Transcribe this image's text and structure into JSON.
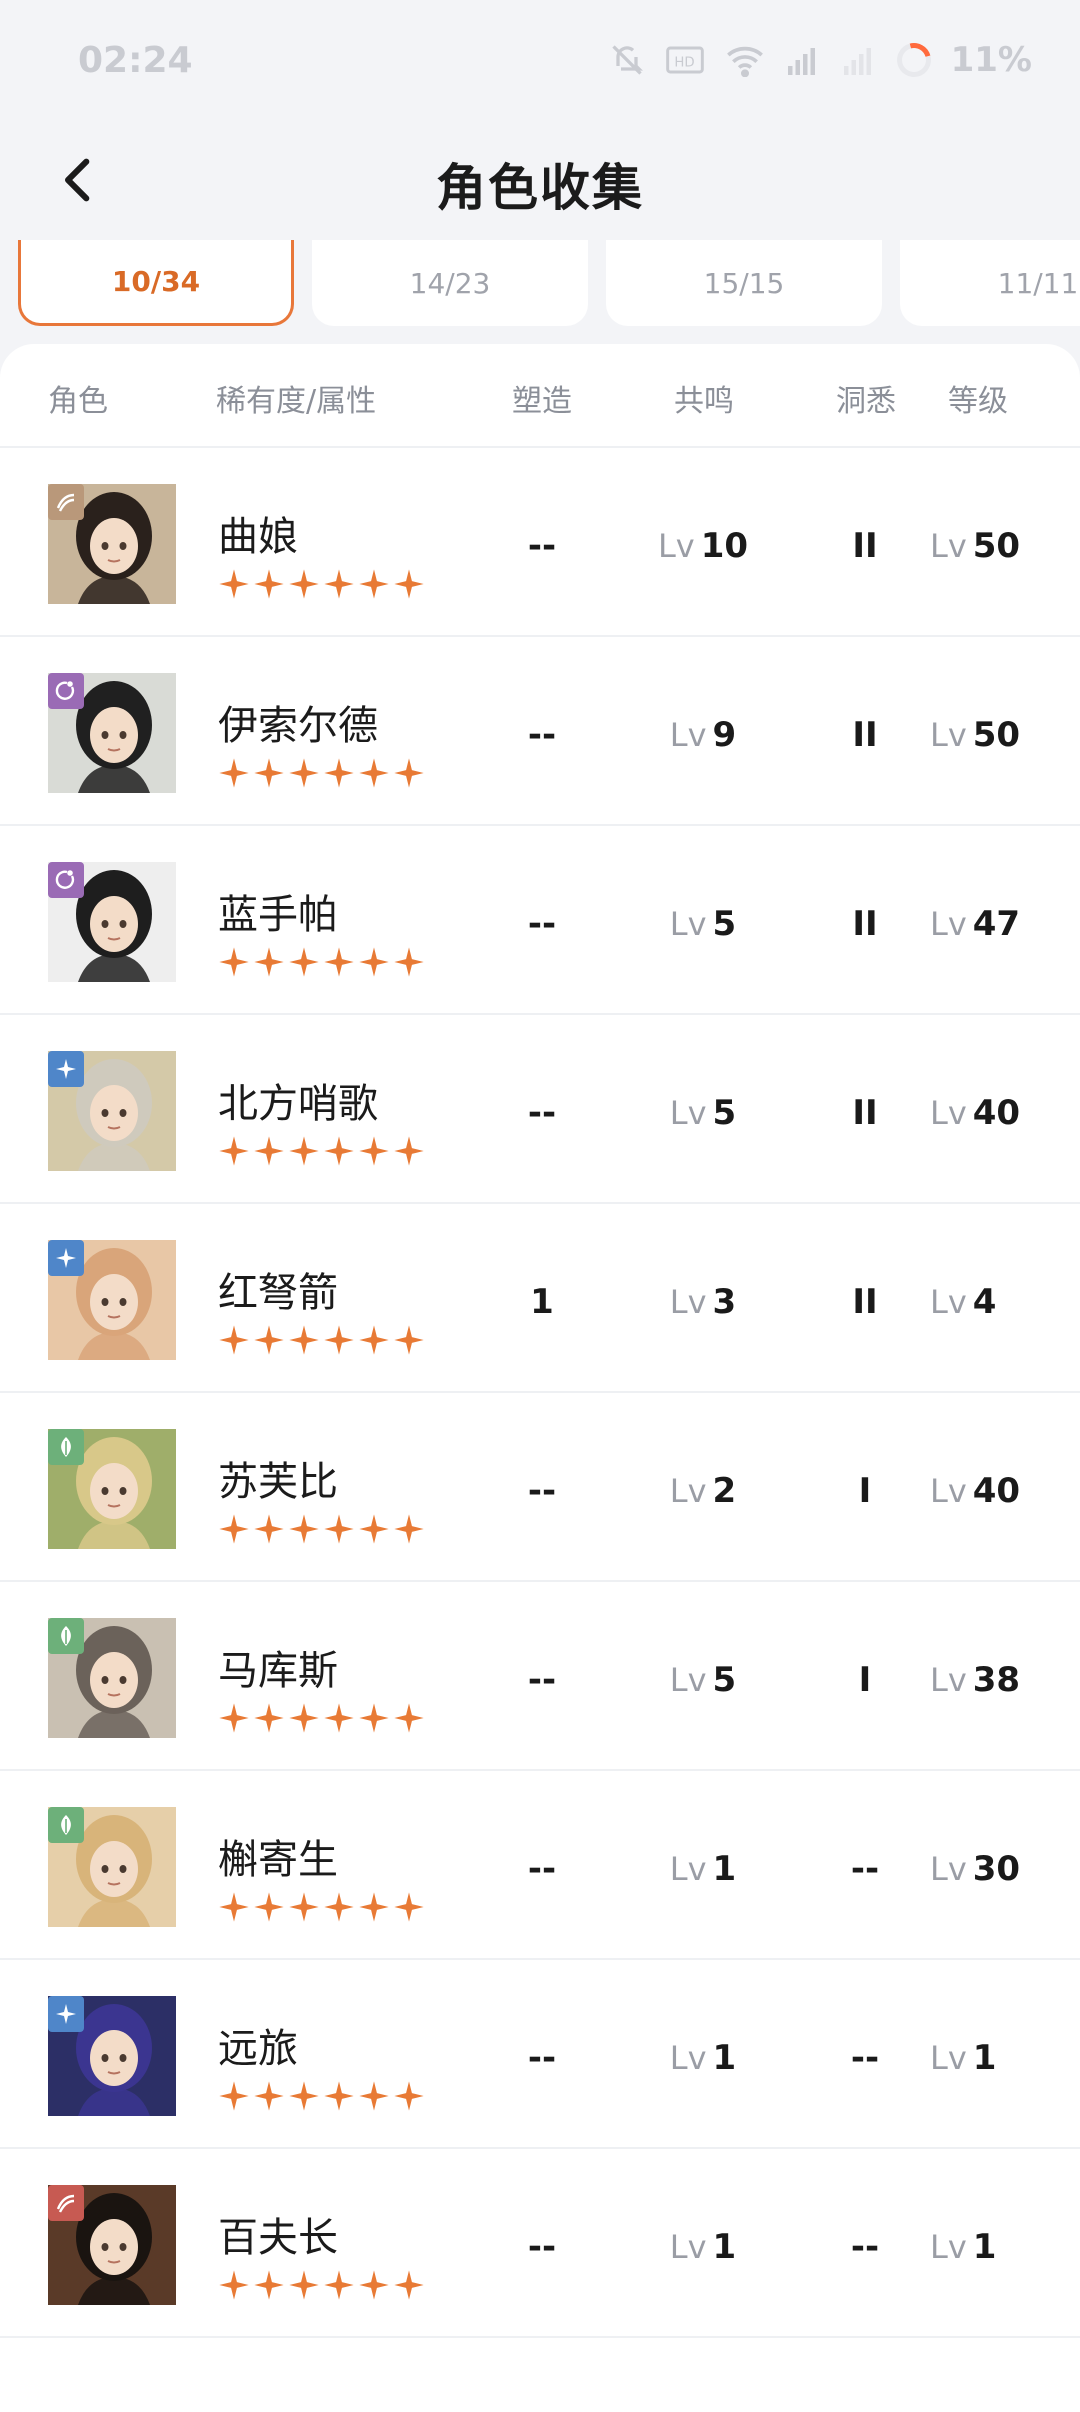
{
  "status_bar": {
    "time": "02:24",
    "battery": "11%",
    "icons": [
      "mute-icon",
      "hd-icon",
      "wifi-icon",
      "signal-icon",
      "signal-icon"
    ]
  },
  "header": {
    "title": "角色收集",
    "back_icon": "chevron-left-icon"
  },
  "tabs": [
    {
      "label": "10/34",
      "active": true
    },
    {
      "label": "14/23",
      "active": false
    },
    {
      "label": "15/15",
      "active": false
    },
    {
      "label": "11/11",
      "active": false
    }
  ],
  "table": {
    "headers": {
      "role": "角色",
      "rarity": "稀有度/属性",
      "shape": "塑造",
      "resonance": "共鸣",
      "insight": "洞悉",
      "level": "等级"
    },
    "lv_prefix": "Lv",
    "rows": [
      {
        "name": "曲娘",
        "attr": "beast",
        "attr_color": "#b9987a",
        "stars": 6,
        "shape": "--",
        "resonance": "10",
        "insight": "II",
        "level": "50",
        "portrait_bg": "#c8b59a",
        "portrait_hair": "#2a211c"
      },
      {
        "name": "伊索尔德",
        "attr": "spirit",
        "attr_color": "#9a6bb5",
        "stars": 6,
        "shape": "--",
        "resonance": "9",
        "insight": "II",
        "level": "50",
        "portrait_bg": "#d9dbd6",
        "portrait_hair": "#202020"
      },
      {
        "name": "蓝手帕",
        "attr": "spirit",
        "attr_color": "#9a6bb5",
        "stars": 6,
        "shape": "--",
        "resonance": "5",
        "insight": "II",
        "level": "47",
        "portrait_bg": "#eeeeee",
        "portrait_hair": "#1e1e1e"
      },
      {
        "name": "北方哨歌",
        "attr": "star",
        "attr_color": "#4f86c9",
        "stars": 6,
        "shape": "--",
        "resonance": "5",
        "insight": "II",
        "level": "40",
        "portrait_bg": "#d4c9a8",
        "portrait_hair": "#cfcabd"
      },
      {
        "name": "红弩箭",
        "attr": "star",
        "attr_color": "#4f86c9",
        "stars": 6,
        "shape": "1",
        "resonance": "3",
        "insight": "II",
        "level": "4",
        "portrait_bg": "#e8c7a6",
        "portrait_hair": "#d9a57a"
      },
      {
        "name": "苏芙比",
        "attr": "plant",
        "attr_color": "#6db07a",
        "stars": 6,
        "shape": "--",
        "resonance": "2",
        "insight": "I",
        "level": "40",
        "portrait_bg": "#9fae6a",
        "portrait_hair": "#d8c889"
      },
      {
        "name": "马库斯",
        "attr": "plant",
        "attr_color": "#6db07a",
        "stars": 6,
        "shape": "--",
        "resonance": "5",
        "insight": "I",
        "level": "38",
        "portrait_bg": "#c9c0b2",
        "portrait_hair": "#6b625a"
      },
      {
        "name": "槲寄生",
        "attr": "plant",
        "attr_color": "#6db07a",
        "stars": 6,
        "shape": "--",
        "resonance": "1",
        "insight": "--",
        "level": "30",
        "portrait_bg": "#e6cfa9",
        "portrait_hair": "#d8b47a"
      },
      {
        "name": "远旅",
        "attr": "star",
        "attr_color": "#4f86c9",
        "stars": 6,
        "shape": "--",
        "resonance": "1",
        "insight": "--",
        "level": "1",
        "portrait_bg": "#2c2f66",
        "portrait_hair": "#3b3590"
      },
      {
        "name": "百夫长",
        "attr": "beast",
        "attr_color": "#c75a52",
        "stars": 6,
        "shape": "--",
        "resonance": "1",
        "insight": "--",
        "level": "1",
        "portrait_bg": "#5a3a28",
        "portrait_hair": "#1a1410"
      }
    ]
  },
  "colors": {
    "accent": "#e8773a",
    "star": "#e87a35"
  }
}
